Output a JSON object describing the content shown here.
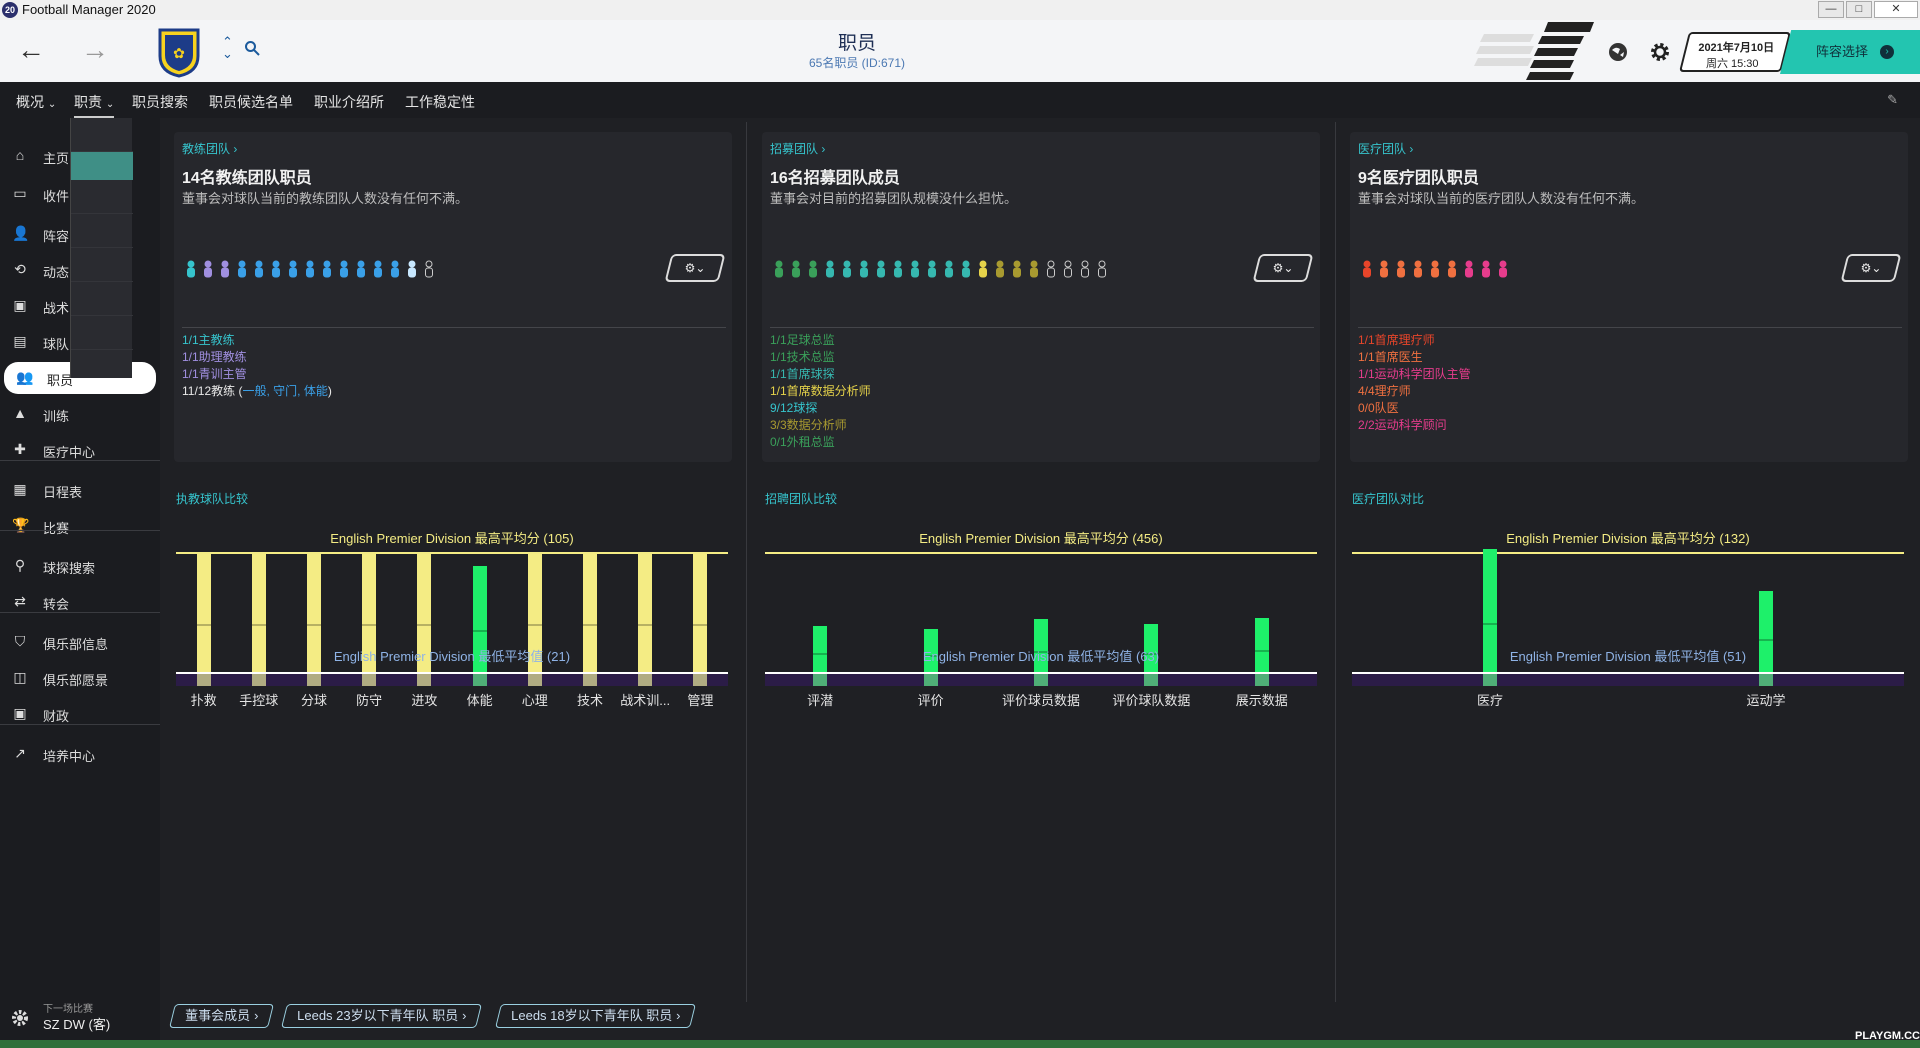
{
  "window": {
    "title": "Football Manager 2020",
    "icon_label": "20",
    "controls": [
      "—",
      "□",
      "✕"
    ]
  },
  "header": {
    "title": "职员",
    "subtitle": "65名职员 (ID:671)",
    "date": "2021年7月10日",
    "time": "周六 15:30",
    "lineup_button": "阵容选择"
  },
  "tabs": [
    {
      "label": "概况",
      "dropdown": true
    },
    {
      "label": "职责",
      "dropdown": true
    },
    {
      "label": "职员搜索"
    },
    {
      "label": "职员候选名单"
    },
    {
      "label": "职业介绍所"
    },
    {
      "label": "工作稳定性"
    }
  ],
  "sidebar": {
    "items": [
      {
        "label": "主页",
        "icon": "home-icon"
      },
      {
        "label": "收件",
        "icon": "inbox-icon"
      },
      {
        "label": "阵容",
        "icon": "squad-icon"
      },
      {
        "label": "动态",
        "icon": "dynamics-icon"
      },
      {
        "label": "战术",
        "icon": "tactics-icon"
      },
      {
        "label": "球队",
        "icon": "team-report-icon"
      },
      {
        "label": "职员",
        "icon": "staff-icon",
        "active": true
      },
      {
        "label": "训练",
        "icon": "training-icon"
      },
      {
        "label": "医疗中心",
        "icon": "medical-icon"
      },
      {
        "label": "日程表",
        "icon": "calendar-icon"
      },
      {
        "label": "比赛",
        "icon": "trophy-icon"
      },
      {
        "label": "球探搜索",
        "icon": "scouting-icon"
      },
      {
        "label": "转会",
        "icon": "transfer-icon"
      },
      {
        "label": "俱乐部信息",
        "icon": "shield-icon"
      },
      {
        "label": "俱乐部愿景",
        "icon": "vision-icon"
      },
      {
        "label": "财政",
        "icon": "finance-icon"
      },
      {
        "label": "培养中心",
        "icon": "development-icon"
      }
    ],
    "next_match_label": "下一场比赛",
    "next_match_value": "SZ DW (客)"
  },
  "cards": [
    {
      "link": "教练团队",
      "title": "14名教练团队职员",
      "desc": "董事会对球队当前的教练团队人数没有任何不满。",
      "people_colors": [
        "#36c4cd",
        "#a08fe0",
        "#a08fe0",
        "#3aa0e8",
        "#3aa0e8",
        "#3aa0e8",
        "#3aa0e8",
        "#3aa0e8",
        "#3aa0e8",
        "#3aa0e8",
        "#3aa0e8",
        "#3aa0e8",
        "#3aa0e8",
        "#c8e8ff",
        "outline"
      ],
      "roles": [
        {
          "text": "1/1主教练",
          "color": "#36c4cd"
        },
        {
          "text": "1/1助理教练",
          "color": "#a08fe0"
        },
        {
          "text": "1/1青训主管",
          "color": "#a08fe0"
        },
        {
          "text": "11/12教练 (",
          "color": "#e8e8e8",
          "extra": "一般, 守门, 体能",
          "extra_color": "#3aa0e8",
          "tail": ")"
        }
      ]
    },
    {
      "link": "招募团队",
      "title": "16名招募团队成员",
      "desc": "董事会对目前的招募团队规模没什么担忧。",
      "people_colors": [
        "#3aa05a",
        "#3aa05a",
        "#3aa05a",
        "#36b8b0",
        "#36b8b0",
        "#36b8b0",
        "#36b8b0",
        "#36b8b0",
        "#36b8b0",
        "#36b8b0",
        "#36b8b0",
        "#36b8b0",
        "#e6d34a",
        "#a89a30",
        "#a89a30",
        "#a89a30",
        "outline",
        "outline",
        "outline",
        "outline"
      ],
      "roles": [
        {
          "text": "1/1足球总监",
          "color": "#3aa05a"
        },
        {
          "text": "1/1技术总监",
          "color": "#3aa05a"
        },
        {
          "text": "1/1首席球探",
          "color": "#36b8b0"
        },
        {
          "text": "1/1首席数据分析师",
          "color": "#e6d34a"
        },
        {
          "text": "9/12球探",
          "color": "#36c4cd"
        },
        {
          "text": "3/3数据分析师",
          "color": "#a89a30"
        },
        {
          "text": "0/1外租总监",
          "color": "#3aa05a"
        }
      ]
    },
    {
      "link": "医疗团队",
      "title": "9名医疗团队职员",
      "desc": "董事会对球队当前的医疗团队人数没有任何不满。",
      "people_colors": [
        "#e8452a",
        "#f07040",
        "#f07040",
        "#f07040",
        "#f07040",
        "#f07040",
        "#e63c8c",
        "#e63c8c",
        "#e63c8c"
      ],
      "roles": [
        {
          "text": "1/1首席理疗师",
          "color": "#e8452a"
        },
        {
          "text": "1/1首席医生",
          "color": "#f07040"
        },
        {
          "text": "1/1运动科学团队主管",
          "color": "#e63c8c"
        },
        {
          "text": "4/4理疗师",
          "color": "#f07040"
        },
        {
          "text": "0/0队医",
          "color": "#f07040"
        },
        {
          "text": "2/2运动科学顾问",
          "color": "#e63c8c"
        }
      ]
    }
  ],
  "comparisons": [
    {
      "title": "执教球队比较",
      "chart_data": {
        "type": "bar",
        "max_label": "English Premier Division 最高平均分 (105)",
        "min_label": "English Premier Division 最低平均值 (21)",
        "max": 105,
        "min": 21,
        "categories": [
          "扑救",
          "手控球",
          "分球",
          "防守",
          "进攻",
          "体能",
          "心理",
          "技术",
          "战术训...",
          "管理"
        ],
        "values": [
          105,
          105,
          105,
          105,
          105,
          95,
          105,
          105,
          105,
          105
        ],
        "colors": [
          "#f4ec84",
          "#f4ec84",
          "#f4ec84",
          "#f4ec84",
          "#f4ec84",
          "#1ef06a",
          "#f4ec84",
          "#f4ec84",
          "#f4ec84",
          "#f4ec84"
        ]
      }
    },
    {
      "title": "招聘团队比较",
      "chart_data": {
        "type": "bar",
        "max_label": "English Premier Division 最高平均分 (456)",
        "min_label": "English Premier Division 最低平均值 (63)",
        "max": 456,
        "min": 63,
        "categories": [
          "评潜",
          "评价",
          "评价球员数据",
          "评价球队数据",
          "展示数据"
        ],
        "values": [
          215,
          205,
          235,
          220,
          240
        ],
        "colors": [
          "#1ef06a",
          "#1ef06a",
          "#1ef06a",
          "#1ef06a",
          "#1ef06a"
        ]
      }
    },
    {
      "title": "医疗团队对比",
      "chart_data": {
        "type": "bar",
        "max_label": "English Premier Division 最高平均分 (132)",
        "min_label": "English Premier Division 最低平均值 (51)",
        "max": 132,
        "min": 51,
        "categories": [
          "医疗",
          "运动学"
        ],
        "values": [
          134,
          106
        ],
        "colors": [
          "#1ef06a",
          "#1ef06a"
        ]
      }
    }
  ],
  "bottom_buttons": [
    "董事会成员",
    "Leeds 23岁以下青年队 职员",
    "Leeds 18岁以下青年队 职员"
  ],
  "watermark": "PLAYGM.CC"
}
